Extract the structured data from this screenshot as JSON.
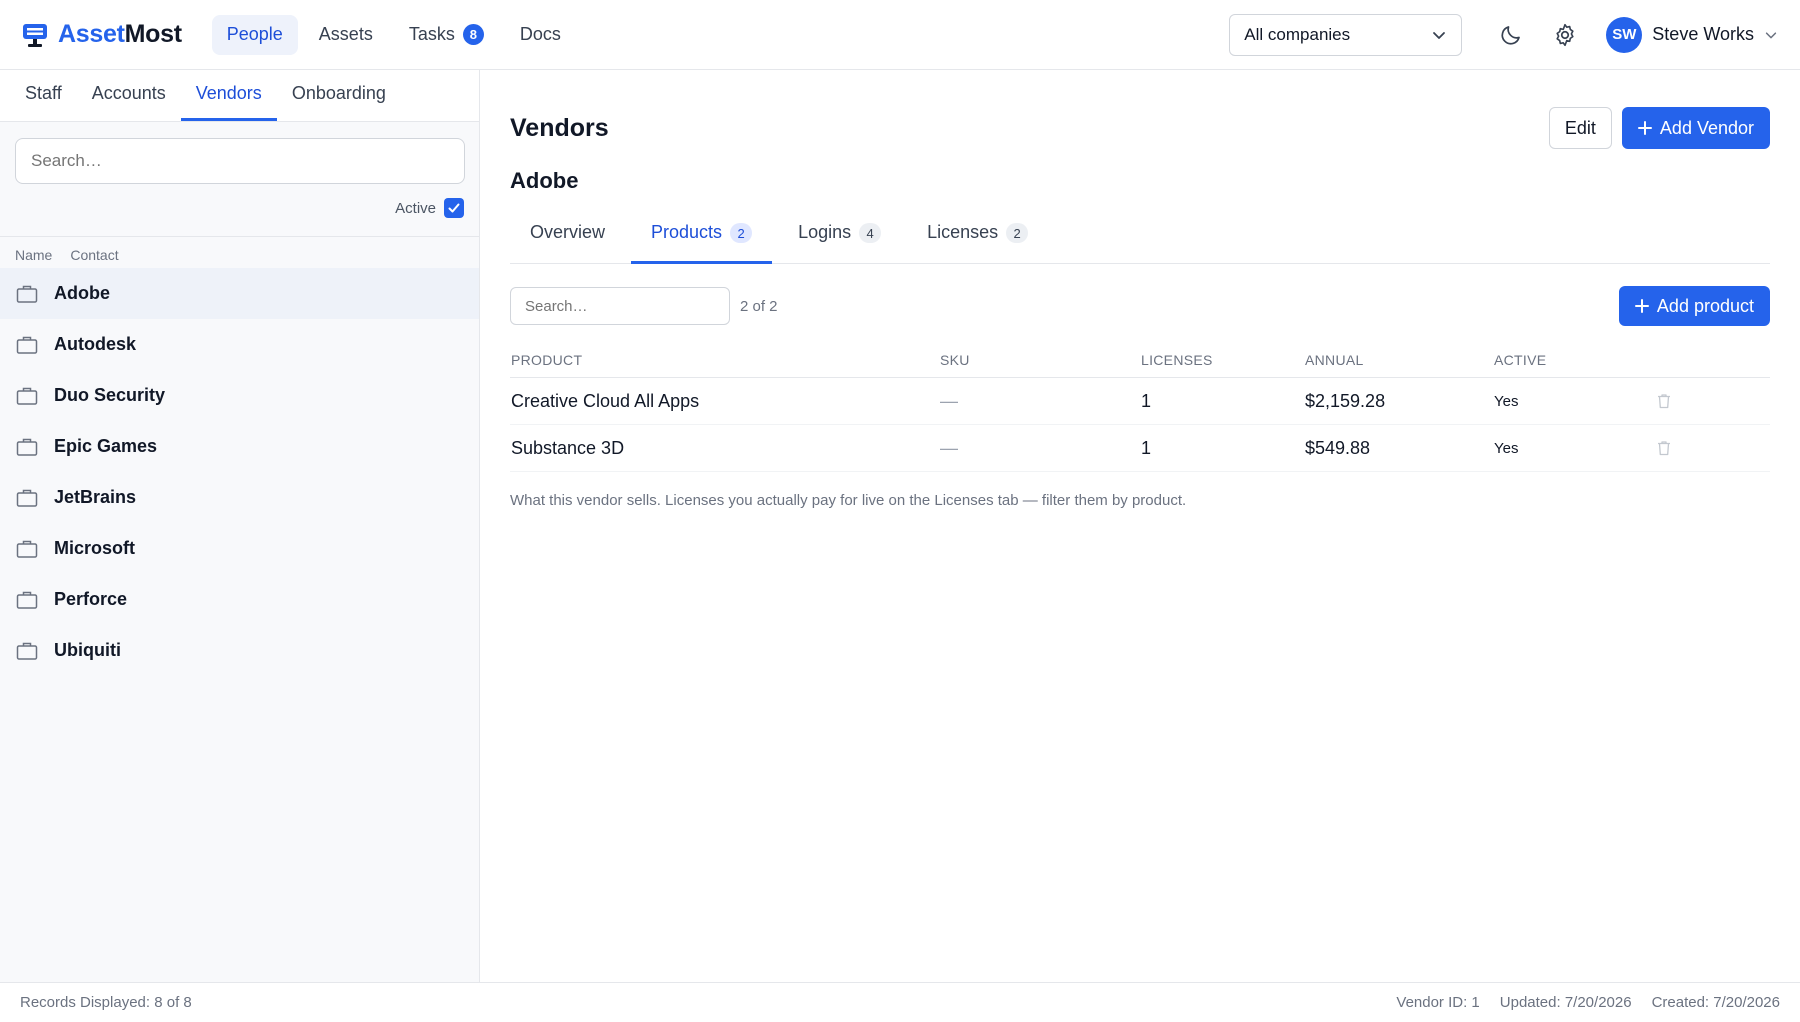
{
  "brand": {
    "part1": "Asset",
    "part2": "Most"
  },
  "nav": [
    {
      "label": "People",
      "active": true
    },
    {
      "label": "Assets"
    },
    {
      "label": "Tasks",
      "badge": "8"
    },
    {
      "label": "Docs"
    }
  ],
  "company_select": {
    "value": "All companies"
  },
  "user": {
    "initials": "SW",
    "name": "Steve Works"
  },
  "sidebar": {
    "tabs": [
      "Staff",
      "Accounts",
      "Vendors",
      "Onboarding"
    ],
    "search_placeholder": "Search…",
    "active_label": "Active",
    "columns": [
      "Name",
      "Contact"
    ],
    "vendors": [
      "Adobe",
      "Autodesk",
      "Duo Security",
      "Epic Games",
      "JetBrains",
      "Microsoft",
      "Perforce",
      "Ubiquiti"
    ]
  },
  "main": {
    "title": "Vendors",
    "edit_label": "Edit",
    "add_vendor_label": "Add Vendor",
    "vendor_name": "Adobe",
    "tabs": [
      {
        "label": "Overview"
      },
      {
        "label": "Products",
        "count": "2"
      },
      {
        "label": "Logins",
        "count": "4"
      },
      {
        "label": "Licenses",
        "count": "2"
      }
    ],
    "search_placeholder": "Search…",
    "count_text": "2 of 2",
    "add_product_label": "Add product",
    "columns": [
      "PRODUCT",
      "SKU",
      "LICENSES",
      "ANNUAL",
      "ACTIVE"
    ],
    "rows": [
      {
        "product": "Creative Cloud All Apps",
        "sku": "—",
        "licenses": "1",
        "annual": "$2,159.28",
        "active": "Yes"
      },
      {
        "product": "Substance 3D",
        "sku": "—",
        "licenses": "1",
        "annual": "$549.88",
        "active": "Yes"
      }
    ],
    "note": "What this vendor sells. Licenses you actually pay for live on the Licenses tab — filter them by product."
  },
  "footer": {
    "records": "Records Displayed: 8 of 8",
    "vendor_id": "Vendor ID: 1",
    "updated": "Updated: 7/20/2026",
    "created": "Created: 7/20/2026"
  }
}
